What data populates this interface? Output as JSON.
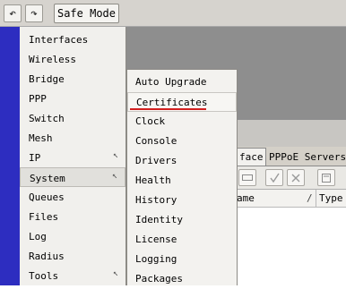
{
  "toolbar": {
    "undo_icon": "↶",
    "redo_icon": "↷",
    "safe_mode_label": "Safe Mode"
  },
  "main_menu": {
    "items": [
      {
        "label": "Interfaces"
      },
      {
        "label": "Wireless"
      },
      {
        "label": "Bridge"
      },
      {
        "label": "PPP"
      },
      {
        "label": "Switch"
      },
      {
        "label": "Mesh"
      },
      {
        "label": "IP",
        "has_submenu": true
      },
      {
        "label": "System",
        "has_submenu": true,
        "selected": true
      },
      {
        "label": "Queues"
      },
      {
        "label": "Files"
      },
      {
        "label": "Log"
      },
      {
        "label": "Radius"
      },
      {
        "label": "Tools",
        "has_submenu": true
      }
    ],
    "submenu_arrow": "↖"
  },
  "system_submenu": {
    "items": [
      {
        "label": "Auto Upgrade"
      },
      {
        "label": "Certificates",
        "highlighted": true,
        "annotation_color": "#d21f1f"
      },
      {
        "label": "Clock"
      },
      {
        "label": "Console"
      },
      {
        "label": "Drivers"
      },
      {
        "label": "Health"
      },
      {
        "label": "History"
      },
      {
        "label": "Identity"
      },
      {
        "label": "License"
      },
      {
        "label": "Logging"
      },
      {
        "label": "Packages"
      }
    ]
  },
  "background_window": {
    "tabs": [
      "face",
      "PPPoE Servers"
    ],
    "toolbar_icons": [
      "minus-icon",
      "check-icon",
      "cross-icon",
      "note-icon"
    ],
    "columns": [
      "ame",
      "Type"
    ],
    "sort_indicator": "/"
  },
  "colors": {
    "nav_strip": "#2d2dc0",
    "workspace": "#8e8e8e",
    "menu_bg": "#f1f0ed"
  }
}
